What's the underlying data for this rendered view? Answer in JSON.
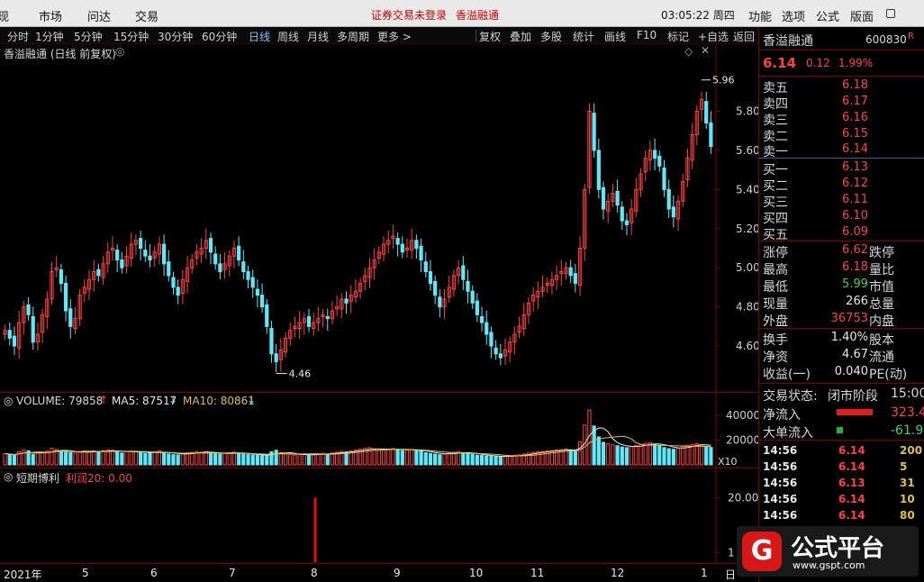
{
  "menu": [
    "现",
    "市场",
    "问达",
    "交易"
  ],
  "status_warning": "证券交易未登录",
  "status_stock": "香溢融通",
  "clock": "03:05:22 周四",
  "right_menu": [
    "功能",
    "选项",
    "公式",
    "版面"
  ],
  "periods": [
    "分时",
    "1分钟",
    "5分钟",
    "15分钟",
    "30分钟",
    "60分钟",
    "日线",
    "周线",
    "月线",
    "多周期",
    "更多 >"
  ],
  "active_period": "日线",
  "tools": [
    "复权",
    "叠加",
    "多股",
    "统计",
    "画线",
    "F10",
    "标记",
    "+自选",
    "返回"
  ],
  "chart_title": "香溢融通 (日线 前复权)",
  "volume_label": "VOLUME: 79858",
  "ma5_label": "MA5: 87517",
  "ma10_label": "MA10: 80861",
  "x10_label": "X10",
  "indicator_name": "短期博利",
  "indicator_value": "利润20: 0.00",
  "colors": {
    "up": "#ff4040",
    "down": "#5ee8f8",
    "ma5": "#e8e8e8",
    "ma10": "#e0c040",
    "frame": "#7a0000"
  },
  "chart_data": [
    {
      "type": "candlestick",
      "ylim": [
        4.43,
        6.06
      ],
      "yticks": [
        "5.80",
        "5.60",
        "5.40",
        "5.20",
        "5.00",
        "4.80",
        "4.60"
      ],
      "high_mark": "5.96",
      "low_mark": "4.46",
      "close_path": [
        4.68,
        4.64,
        4.6,
        4.72,
        4.8,
        4.76,
        4.62,
        4.66,
        4.76,
        4.84,
        4.98,
        5.0,
        4.92,
        4.78,
        4.7,
        4.74,
        4.86,
        4.9,
        4.94,
        4.98,
        4.96,
        5.02,
        5.08,
        5.1,
        5.04,
        5.0,
        5.06,
        5.12,
        5.14,
        5.1,
        5.06,
        5.04,
        5.08,
        5.12,
        5.02,
        4.96,
        4.9,
        4.86,
        4.94,
        5.0,
        5.04,
        5.08,
        5.1,
        5.14,
        5.08,
        5.02,
        4.98,
        5.02,
        5.06,
        5.1,
        5.04,
        4.98,
        4.94,
        4.9,
        4.86,
        4.8,
        4.7,
        4.56,
        4.52,
        4.58,
        4.64,
        4.68,
        4.7,
        4.72,
        4.74,
        4.7,
        4.72,
        4.74,
        4.76,
        4.74,
        4.78,
        4.8,
        4.84,
        4.82,
        4.86,
        4.88,
        4.92,
        4.96,
        5.0,
        5.04,
        5.08,
        5.12,
        5.14,
        5.16,
        5.12,
        5.08,
        5.1,
        5.14,
        5.1,
        5.04,
        4.98,
        4.92,
        4.86,
        4.8,
        4.84,
        4.9,
        4.96,
        5.0,
        4.94,
        4.88,
        4.82,
        4.76,
        4.72,
        4.66,
        4.6,
        4.56,
        4.54,
        4.58,
        4.62,
        4.66,
        4.7,
        4.76,
        4.82,
        4.86,
        4.88,
        4.9,
        4.92,
        4.94,
        4.96,
        4.98,
        5.0,
        4.96,
        4.92,
        5.1,
        5.4,
        5.8,
        5.6,
        5.4,
        5.3,
        5.34,
        5.38,
        5.32,
        5.24,
        5.22,
        5.3,
        5.4,
        5.48,
        5.56,
        5.6,
        5.56,
        5.52,
        5.4,
        5.3,
        5.26,
        5.34,
        5.44,
        5.56,
        5.68,
        5.8,
        5.86,
        5.74,
        5.62
      ],
      "volume": {
        "ylim": [
          0,
          48000
        ],
        "yticks": [
          "40000",
          "20000"
        ],
        "values": [
          9100,
          8300,
          7800,
          10600,
          12100,
          11400,
          8500,
          9400,
          9900,
          11100,
          13300,
          12500,
          11500,
          10200,
          9800,
          9500,
          10700,
          11300,
          10300,
          11100,
          10800,
          11500,
          12000,
          11800,
          10400,
          9600,
          10700,
          11200,
          10800,
          9800,
          9300,
          9500,
          10400,
          11300,
          9600,
          8800,
          8300,
          8100,
          9200,
          9700,
          10100,
          10500,
          10200,
          10800,
          9600,
          8900,
          8700,
          9300,
          9800,
          10300,
          9500,
          8700,
          8400,
          8000,
          7900,
          7600,
          7300,
          10600,
          11800,
          9900,
          8700,
          8300,
          8000,
          8200,
          8600,
          8100,
          8300,
          8800,
          9300,
          8900,
          9700,
          10200,
          10900,
          10500,
          11200,
          11900,
          12600,
          13300,
          13900,
          12600,
          11800,
          12200,
          12800,
          13200,
          12400,
          11500,
          11800,
          12400,
          11700,
          10900,
          9800,
          9200,
          8700,
          8200,
          8800,
          9500,
          10200,
          10700,
          9900,
          9100,
          8500,
          7900,
          7600,
          7200,
          6900,
          6700,
          6600,
          6900,
          7300,
          7700,
          8100,
          8800,
          9600,
          10100,
          10500,
          10900,
          11300,
          11600,
          12000,
          12400,
          12900,
          11700,
          11000,
          18800,
          32100,
          44200,
          31400,
          22600,
          18200,
          17300,
          16100,
          15500,
          14400,
          13900,
          14800,
          15700,
          16600,
          17400,
          17900,
          16800,
          15500,
          14000,
          13100,
          12600,
          13600,
          14900,
          15800,
          16600,
          17100,
          16400,
          15000,
          14100
        ]
      }
    },
    {
      "type": "bar",
      "name": "短期博利",
      "ylim": [
        0,
        24
      ],
      "yticks": [
        "20.00",
        "1"
      ],
      "spike_value": 20
    }
  ],
  "date_axis": [
    "2021年",
    "5",
    "6",
    "7",
    "8",
    "9",
    "10",
    "11",
    "12",
    "1",
    "日"
  ],
  "quote": {
    "name": "香溢融通",
    "code": "600830",
    "flag": "R",
    "price": "6.14",
    "change": "0.12",
    "pct": "1.99%",
    "sells": [
      {
        "label": "卖五",
        "price": "6.18"
      },
      {
        "label": "卖四",
        "price": "6.17"
      },
      {
        "label": "卖三",
        "price": "6.16"
      },
      {
        "label": "卖二",
        "price": "6.15"
      },
      {
        "label": "卖一",
        "price": "6.14"
      }
    ],
    "buys": [
      {
        "label": "买一",
        "price": "6.13"
      },
      {
        "label": "买二",
        "price": "6.12"
      },
      {
        "label": "买三",
        "price": "6.11"
      },
      {
        "label": "买四",
        "price": "6.10"
      },
      {
        "label": "买五",
        "price": "6.09"
      }
    ],
    "stats": [
      {
        "label": "涨停",
        "value": "6.62",
        "label2": "跌停"
      },
      {
        "label": "最高",
        "value": "6.18",
        "label2": "量比"
      },
      {
        "label": "最低",
        "value": "5.99",
        "label2": "市值"
      },
      {
        "label": "现量",
        "value": "266",
        "label2": "总量"
      },
      {
        "label": "外盘",
        "value": "36753",
        "label2": "内盘"
      }
    ],
    "stats2": [
      {
        "label": "换手",
        "value": "1.40%",
        "label2": "股本"
      },
      {
        "label": "净资",
        "value": "4.67",
        "label2": "流通"
      },
      {
        "label": "收益(一)",
        "value": "0.040",
        "label2": "PE(动)"
      }
    ],
    "trade_state_label": "交易状态:",
    "trade_state": "闭市阶段",
    "trade_time": "15:00",
    "net_inflow_label": "净流入",
    "net_inflow": "323.4",
    "big_inflow_label": "大单流入",
    "big_inflow": "-61.9",
    "ticks": [
      {
        "time": "14:56",
        "price": "6.14",
        "vol": "200"
      },
      {
        "time": "14:56",
        "price": "6.14",
        "vol": "5"
      },
      {
        "time": "14:56",
        "price": "6.13",
        "vol": "31"
      },
      {
        "time": "14:56",
        "price": "6.14",
        "vol": "10"
      },
      {
        "time": "14:56",
        "price": "6.14",
        "vol": "80"
      }
    ]
  },
  "logo": {
    "name": "公式平台",
    "url": "www.gspt.com",
    "mark": "G"
  }
}
